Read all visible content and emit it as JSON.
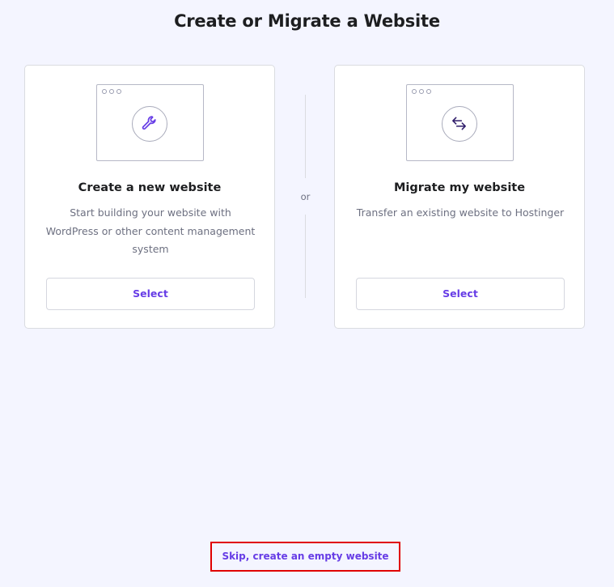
{
  "page": {
    "title": "Create or Migrate a Website"
  },
  "cards": [
    {
      "icon": "wrench-icon",
      "title": "Create a new website",
      "description": "Start building your website with WordPress or other content management system",
      "button_label": "Select"
    },
    {
      "icon": "swap-arrows-icon",
      "title": "Migrate my website",
      "description": "Transfer an existing website to Hostinger",
      "button_label": "Select"
    }
  ],
  "divider": {
    "label": "or"
  },
  "footer": {
    "skip_label": "Skip, create an empty website"
  },
  "colors": {
    "background": "#f4f5ff",
    "accent": "#673de6",
    "title_text": "#1d1e20",
    "muted_text": "#6d7081",
    "highlight_border": "#e00000"
  }
}
